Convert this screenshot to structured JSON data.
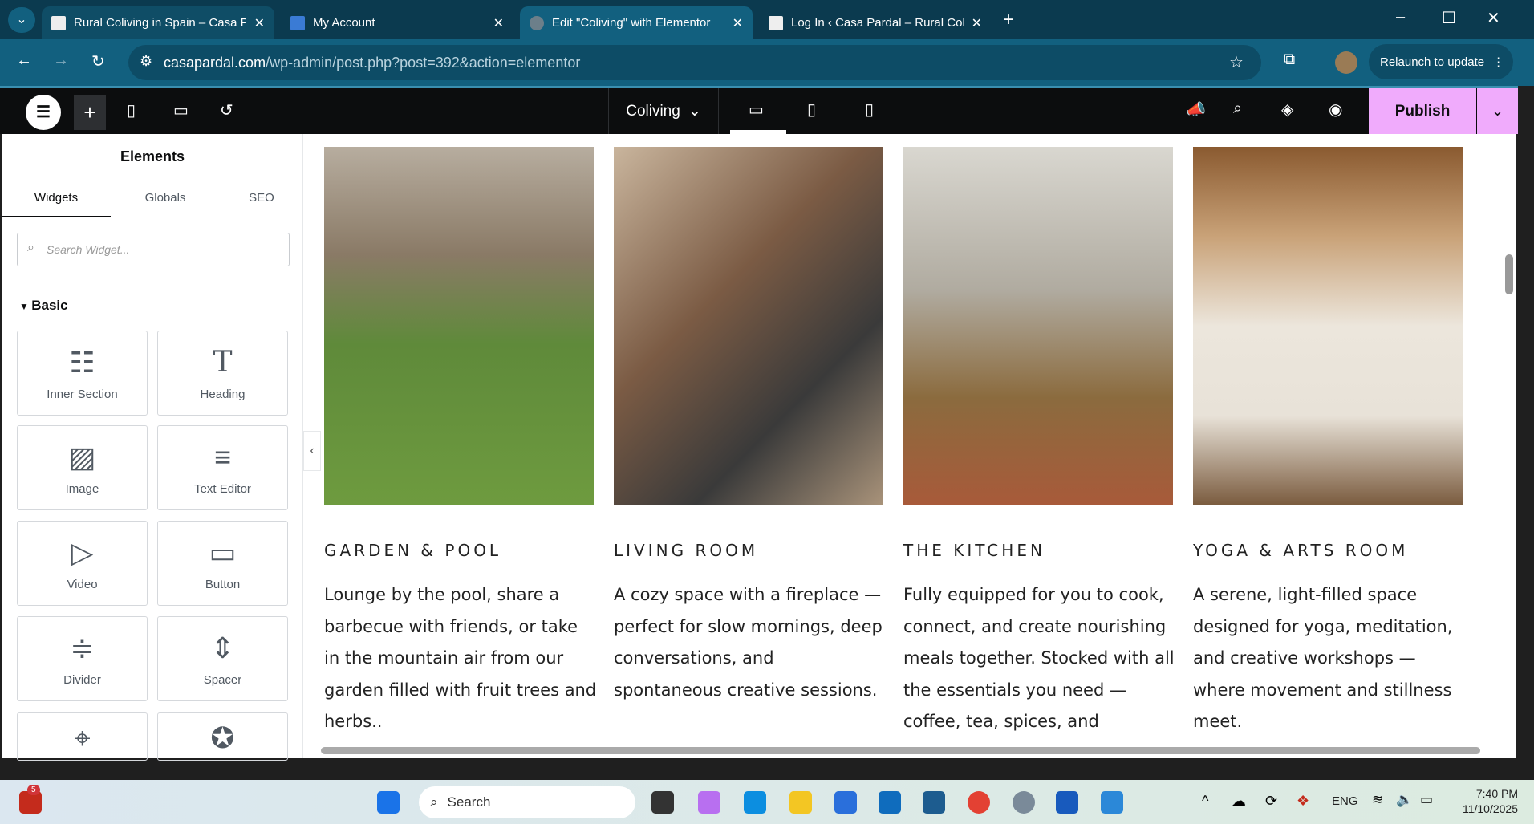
{
  "browser": {
    "tabs": [
      {
        "title": "Rural Coliving in Spain – Casa Pardal"
      },
      {
        "title": "My Account"
      },
      {
        "title": "Edit \"Coliving\" with Elementor",
        "active": true
      },
      {
        "title": "Log In ‹ Casa Pardal – Rural Coliving"
      }
    ],
    "url_host": "casapardal.com",
    "url_path": "/wp-admin/post.php?post=392&action=elementor",
    "relaunch": "Relaunch to update"
  },
  "editor": {
    "page_name": "Coliving",
    "publish": "Publish"
  },
  "panel": {
    "title": "Elements",
    "tabs": [
      "Widgets",
      "Globals",
      "SEO"
    ],
    "search_placeholder": "Search Widget...",
    "section": "Basic",
    "widgets": [
      "Inner Section",
      "Heading",
      "Image",
      "Text Editor",
      "Video",
      "Button",
      "Divider",
      "Spacer"
    ]
  },
  "cards": [
    {
      "title": "GARDEN & POOL",
      "text": "Lounge by the pool, share a barbecue with friends, or take in the mountain air from our garden filled with fruit trees and herbs.."
    },
    {
      "title": "LIVING ROOM",
      "text": "A cozy space with a fireplace — perfect for slow mornings, deep conversations, and spontaneous creative sessions."
    },
    {
      "title": "THE KITCHEN",
      "text": "Fully equipped for you to cook, connect, and create nourishing meals together. Stocked with all the essentials you need — coffee, tea, spices, and"
    },
    {
      "title": "YOGA & ARTS ROOM",
      "text": "A serene, light-filled space designed for yoga, meditation, and creative workshops — where movement and stillness meet."
    }
  ],
  "taskbar": {
    "search": "Search",
    "lang": "ENG",
    "time": "7:40 PM",
    "date": "11/10/2025",
    "badge": "5"
  }
}
